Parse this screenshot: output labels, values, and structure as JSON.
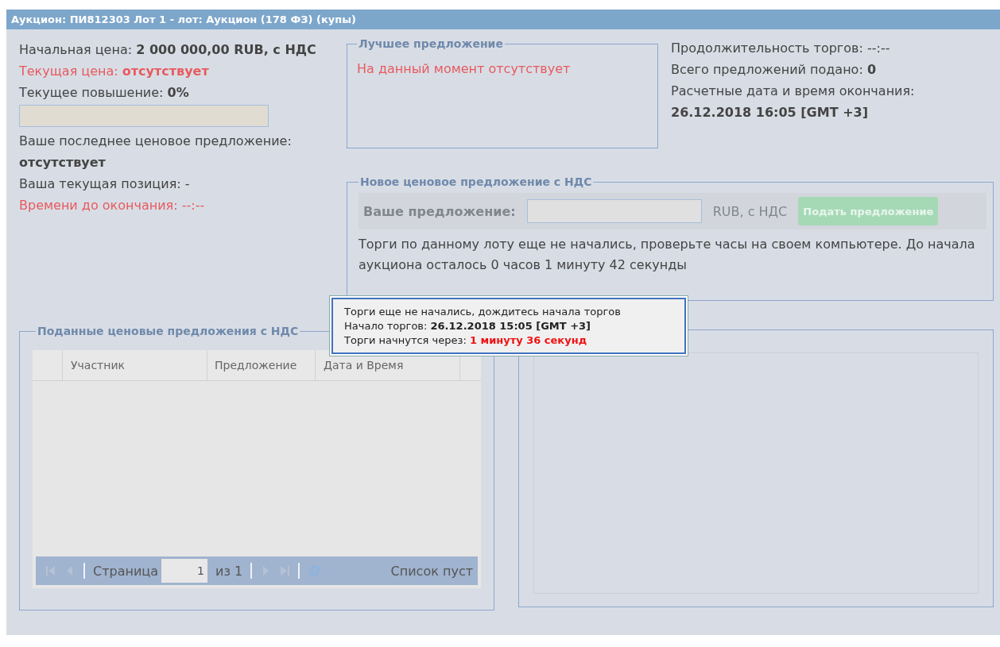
{
  "window": {
    "title": "Аукцион: ПИ812303 Лот 1 - лот: Аукцион (178 ФЗ) (купы)"
  },
  "summary": [
    {
      "label": "Начальная цена: ",
      "value": "2 000 000,00 RUB, с НДС",
      "alert": false
    },
    {
      "label": "Текущая цена: ",
      "value": "отсутствует",
      "alert": true
    },
    {
      "label": "Текущее повышение: ",
      "value": "0%",
      "alert": false
    }
  ],
  "raise_bar": {
    "level": 0
  },
  "your_offer": {
    "label": "Ваше последнее ценовое предложение:",
    "value": "отсутствует"
  },
  "position": {
    "text": "Ваша текущая позиция: -"
  },
  "time_left": {
    "text": "Времени до окончания: --:--"
  },
  "best_offer": {
    "title": "Лучшее предложение",
    "text": "На данный момент отсутствует"
  },
  "stats": [
    {
      "label": "Продолжительность торгов: ",
      "value": "--:--",
      "bold": false
    },
    {
      "label": "Всего предложений подано: ",
      "value": "0",
      "bold": true
    }
  ],
  "end_time": {
    "label": "Расчетные дата и время окончания:",
    "value": "26.12.2018 16:05 [GMT +3]"
  },
  "new_offer": {
    "title": "Новое ценовое предложение с НДС",
    "field_label": "Ваше предложение:",
    "unit": "RUB, с НДС",
    "button": "Подать предложение",
    "disabled": true,
    "note": "Торги по данному лоту еще не начались, проверьте часы на своем компьютере. До начала аукциона осталось 0 часов 1 минуту 42 секунды"
  },
  "tooltip": {
    "line1": "Торги еще не начались, дождитесь начала торгов",
    "start_label": "Начало торгов: ",
    "start_value": "26.12.2018 15:05 [GMT +3]",
    "left_label": "Торги начнутся через: ",
    "left_value": "1 минуту 36 секунд"
  },
  "offers": {
    "title": "Поданные ценовые предложения с НДС",
    "columns": [
      "Участник",
      "Предложение",
      "Дата и Время"
    ],
    "pager": {
      "page_label": "Страница",
      "page": "1",
      "of": "из 1",
      "status": "Список пуст"
    }
  }
}
